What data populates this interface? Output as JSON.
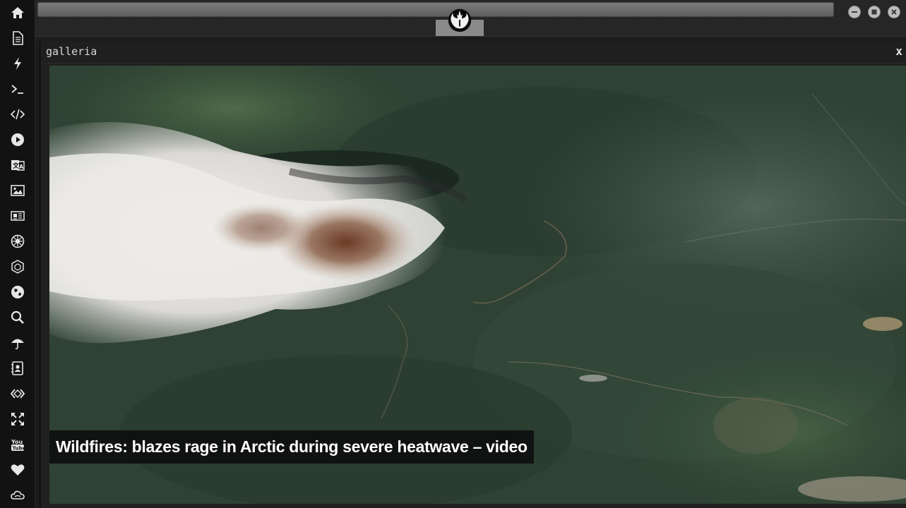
{
  "sidebar": {
    "items": [
      {
        "icon": "home-icon"
      },
      {
        "icon": "document-icon"
      },
      {
        "icon": "lightning-icon"
      },
      {
        "icon": "terminal-icon"
      },
      {
        "icon": "code-icon"
      },
      {
        "icon": "play-icon"
      },
      {
        "icon": "translate-icon"
      },
      {
        "icon": "image-icon"
      },
      {
        "icon": "newspaper-icon"
      },
      {
        "icon": "galactic-empire-icon"
      },
      {
        "icon": "hexagon-icon"
      },
      {
        "icon": "globe-icon"
      },
      {
        "icon": "search-icon"
      },
      {
        "icon": "umbrella-icon"
      },
      {
        "icon": "contacts-icon"
      },
      {
        "icon": "dev-icon"
      },
      {
        "icon": "expand-icon"
      },
      {
        "icon": "youtube-icon"
      },
      {
        "icon": "heart-icon"
      },
      {
        "icon": "cloud-icon"
      }
    ]
  },
  "topbar": {
    "logo_icon": "rebel-alliance-icon",
    "window_controls": [
      "minimize-icon",
      "maximize-icon",
      "close-icon"
    ]
  },
  "panel": {
    "title": "galleria",
    "close_label": "x"
  },
  "gallery": {
    "caption": "Wildfires: blazes rage in Arctic during severe heatwave – video"
  },
  "colors": {
    "background": "#1c1c1c",
    "sidebar": "#121212",
    "forest": "#2e4133",
    "smoke": "#e8e6e2",
    "caption_bg": "#0c0c0c"
  }
}
